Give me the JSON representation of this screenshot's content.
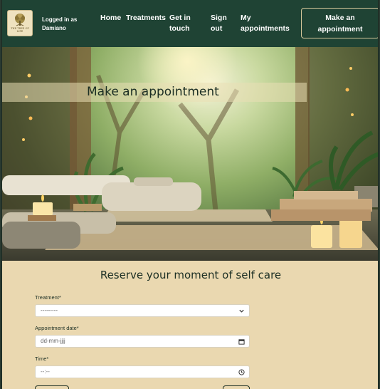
{
  "navbar": {
    "logo_text": "THE TREE OF LIFE",
    "login_status": "Logged in as Damiano",
    "links": {
      "home": "Home",
      "treatments": "Treatments",
      "get_in_touch": "Get in touch",
      "sign_out": "Sign out",
      "my_appointments": "My appointments"
    },
    "cta_label": "Make an appointment"
  },
  "hero": {
    "title": "Make an appointment"
  },
  "form": {
    "heading": "Reserve your moment of self care",
    "treatment": {
      "label": "Treatment*",
      "value": "---------"
    },
    "date": {
      "label": "Appointment date*",
      "placeholder": "dd-mm-jjjj"
    },
    "time": {
      "label": "Time*",
      "placeholder": "--:--"
    }
  },
  "colors": {
    "navbar_bg": "#1f4334",
    "page_bg": "#ead8b0",
    "text_dark": "#1c2f24"
  }
}
